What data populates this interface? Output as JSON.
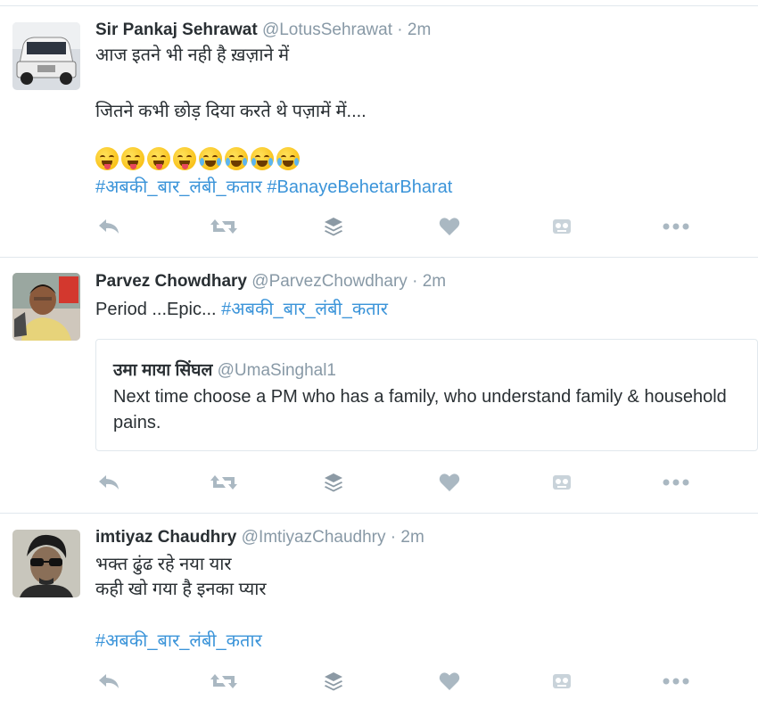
{
  "tweets": [
    {
      "name": "Sir Pankaj Sehrawat",
      "handle": "@LotusSehrawat",
      "dot": "·",
      "time": "2m",
      "lines": [
        "आज इतने भी नही है ख़ज़ाने में",
        "जितने कभी छोड़ दिया करते थे पज़ामें में...."
      ],
      "emojis": [
        "squinting-tongue",
        "squinting-tongue",
        "squinting-tongue",
        "squinting-tongue",
        "tears-of-joy",
        "tears-of-joy",
        "tears-of-joy",
        "tears-of-joy"
      ],
      "hashtags": [
        "#अबकी_बार_लंबी_कतार",
        "#BanayeBehetarBharat"
      ]
    },
    {
      "name": "Parvez Chowdhary",
      "handle": "@ParvezChowdhary",
      "dot": "·",
      "time": "2m",
      "text": "Period ...Epic... ",
      "hashtag": "#अबकी_बार_लंबी_कतार",
      "quote": {
        "name": "उमा माया सिंघल",
        "handle": "@UmaSinghal1",
        "text": "Next time choose a PM who has a family, who understand family & household pains."
      }
    },
    {
      "name": "imtiyaz Chaudhry",
      "handle": "@ImtiyazChaudhry",
      "dot": "·",
      "time": "2m",
      "lines": [
        "भक्त ढुंढ रहे नया यार",
        "कही खो गया है इनका प्यार"
      ],
      "hashtag": "#अबकी_बार_लंबी_कतार"
    }
  ],
  "actions": [
    "reply-icon",
    "retweet-icon",
    "buffer-icon",
    "like-icon",
    "bot-icon",
    "more-icon"
  ],
  "colors": {
    "link": "#3b94d9",
    "icon": "#aab8c2",
    "meta": "#8899a6",
    "text": "#292f33"
  }
}
